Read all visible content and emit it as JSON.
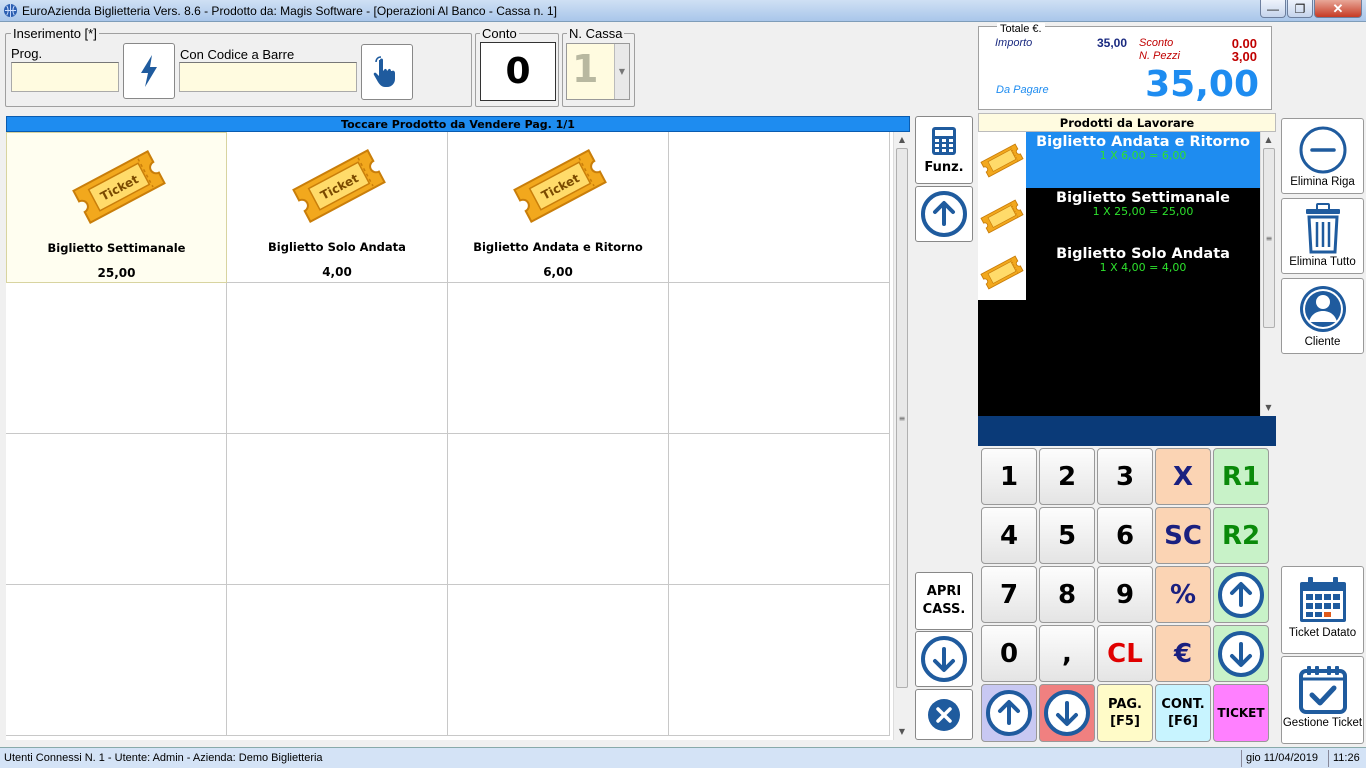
{
  "window": {
    "title": "EuroAzienda Biglietteria Vers. 8.6 - Prodotto da: Magis Software - [Operazioni Al Banco - Cassa n. 1]",
    "minimize": "—",
    "restore": "❐",
    "close": "✕"
  },
  "input_group": {
    "title": "Inserimento [*]",
    "prog_label": "Prog.",
    "prog_value": "",
    "barcode_label": "Con Codice a Barre",
    "barcode_value": ""
  },
  "conto": {
    "label": "Conto",
    "value": "0"
  },
  "cassa": {
    "label": "N. Cassa",
    "value": "1"
  },
  "totals": {
    "title": "Totale €.",
    "importo_label": "Importo",
    "importo_value": "35,00",
    "sconto_label": "Sconto",
    "sconto_value": "0.00",
    "pezzi_label": "N. Pezzi",
    "pezzi_value": "3,00",
    "pagare_label": "Da Pagare",
    "pagare_value": "35,00"
  },
  "products": {
    "header": "Toccare Prodotto da Vendere Pag. 1/1",
    "items": [
      {
        "name": "Biglietto Settimanale",
        "price": "25,00",
        "icon": "ticket-icon",
        "icon_text": "Ticket"
      },
      {
        "name": "Biglietto Solo Andata",
        "price": "4,00",
        "icon": "ticket-icon",
        "icon_text": "Ticket"
      },
      {
        "name": "Biglietto Andata e Ritorno",
        "price": "6,00",
        "icon": "ticket-icon",
        "icon_text": "Ticket"
      }
    ]
  },
  "mid_buttons": {
    "funz": "Funz.",
    "apri_1": "APRI",
    "apri_2": "CASS."
  },
  "work": {
    "title": "Prodotti da Lavorare",
    "items": [
      {
        "name": "Biglietto Andata e Ritorno",
        "calc": "1 X 6,00 = 6,00",
        "active": true
      },
      {
        "name": "Biglietto Settimanale",
        "calc": "1 X 25,00 = 25,00",
        "active": false
      },
      {
        "name": "Biglietto Solo Andata",
        "calc": "1 X 4,00 = 4,00",
        "active": false
      }
    ]
  },
  "keypad": {
    "k1": "1",
    "k2": "2",
    "k3": "3",
    "kx": "X",
    "kr1": "R1",
    "k4": "4",
    "k5": "5",
    "k6": "6",
    "ksc": "SC",
    "kr2": "R2",
    "k7": "7",
    "k8": "8",
    "k9": "9",
    "kpct": "%",
    "k0": "0",
    "kcomma": ",",
    "kcl": "CL",
    "keur": "€",
    "pag_1": "PAG.",
    "pag_2": "[F5]",
    "cont_1": "CONT.",
    "cont_2": "[F6]",
    "ticket": "TICKET"
  },
  "side_buttons": {
    "elimina_riga": "Elimina Riga",
    "elimina_tutto": "Elimina Tutto",
    "cliente": "Cliente",
    "ticket_datato": "Ticket Datato",
    "gestione_ticket": "Gestione Ticket"
  },
  "status": {
    "left": "Utenti Connessi N. 1 - Utente: Admin - Azienda: Demo Biglietteria",
    "date": "gio 11/04/2019",
    "time": "11:26"
  },
  "colors": {
    "accent_blue": "#1e8cf0",
    "total_blue": "#1e8cf0",
    "sconto_red": "#c00000",
    "ticket_orange": "#f2a81d",
    "calc_green": "#2de02d"
  }
}
